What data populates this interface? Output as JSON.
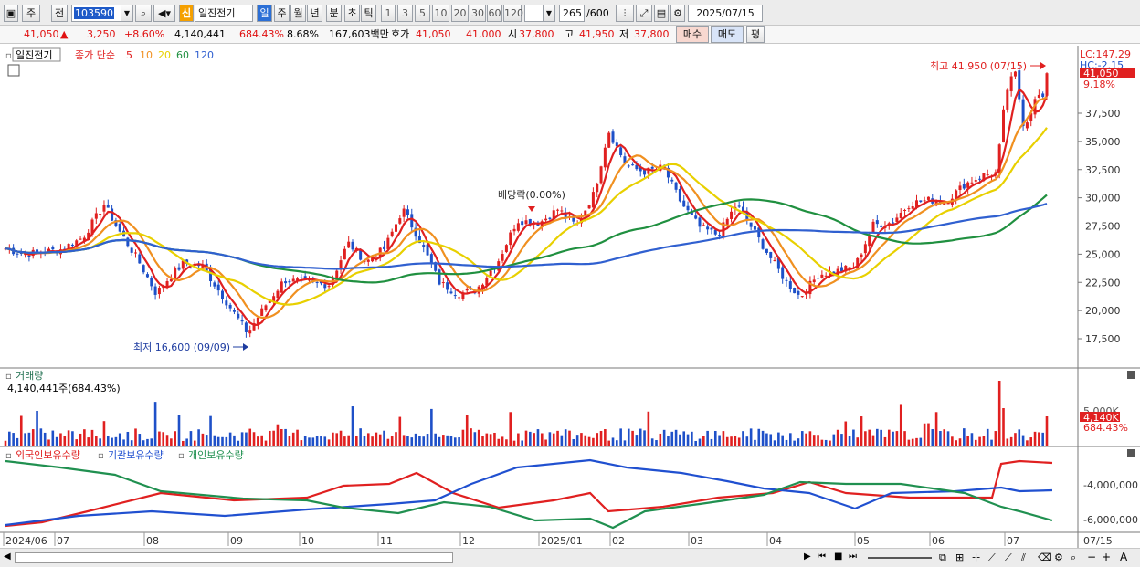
{
  "toolbar": {
    "market": "주",
    "prev": "전",
    "code": "103590",
    "credit_badge": "신",
    "stock_name": "일진전기",
    "periods": [
      "일",
      "주",
      "월",
      "년",
      "분",
      "초",
      "틱"
    ],
    "intervals": [
      "1",
      "3",
      "5",
      "10",
      "20",
      "30",
      "60",
      "120"
    ],
    "count": "265",
    "count_total": "/600",
    "date": "2025/07/15"
  },
  "quote": {
    "price": "41,050",
    "arrow": "▲",
    "change": "3,250",
    "change_pct": "+8.60%",
    "volume": "4,140,441",
    "volume_ratio": "684.43%",
    "turnover": "8.68%",
    "amount": "167,603백만",
    "ask_label": "호가",
    "ask1": "41,050",
    "ask2": "41,000",
    "open_label": "시",
    "open": "37,800",
    "high_label": "고",
    "high": "41,950",
    "low_label": "저",
    "low": "37,800",
    "buy_label": "매수",
    "sell_label": "매도",
    "even_label": "평"
  },
  "price_pane": {
    "name_tag": "일진전기",
    "legend_prefix": "종가 단순",
    "ma": [
      {
        "period": "5",
        "color": "#e02020"
      },
      {
        "period": "10",
        "color": "#f09020"
      },
      {
        "period": "20",
        "color": "#e8d000"
      },
      {
        "period": "60",
        "color": "#209040"
      },
      {
        "period": "120",
        "color": "#3060d0"
      }
    ],
    "lc": "LC:147.29",
    "hc": "HC:-2.15",
    "last_tag": "41,050",
    "last_pct": "9.18%",
    "y_ticks": [
      "37,500",
      "35,000",
      "32,500",
      "30,000",
      "27,500",
      "25,000",
      "22,500",
      "20,000",
      "17,500"
    ],
    "high_note": "최고 41,950 (07/15)",
    "low_note": "최저 16,600 (09/09)",
    "dividend_note": "배당락(0.00%)"
  },
  "volume_pane": {
    "title": "거래량",
    "value": "4,140,441주(684.43%)",
    "y_tick": "5,000K",
    "tag": "4,140K",
    "tag_pct": "684.43%"
  },
  "holding_pane": {
    "legend": [
      {
        "name": "외국인보유수량",
        "color": "#e02020"
      },
      {
        "name": "기관보유수량",
        "color": "#2050d0"
      },
      {
        "name": "개인보유수량",
        "color": "#209050"
      }
    ],
    "y_ticks": [
      "-4,000,000",
      "-6,000,000"
    ]
  },
  "x_axis": {
    "labels": [
      "2024/06",
      "07",
      "08",
      "09",
      "10",
      "11",
      "12",
      "2025/01",
      "02",
      "03",
      "04",
      "05",
      "06",
      "07"
    ],
    "right_label": "07/15"
  },
  "colors": {
    "up": "#e02020",
    "down": "#1e50c8",
    "accent": "#e02020"
  }
}
